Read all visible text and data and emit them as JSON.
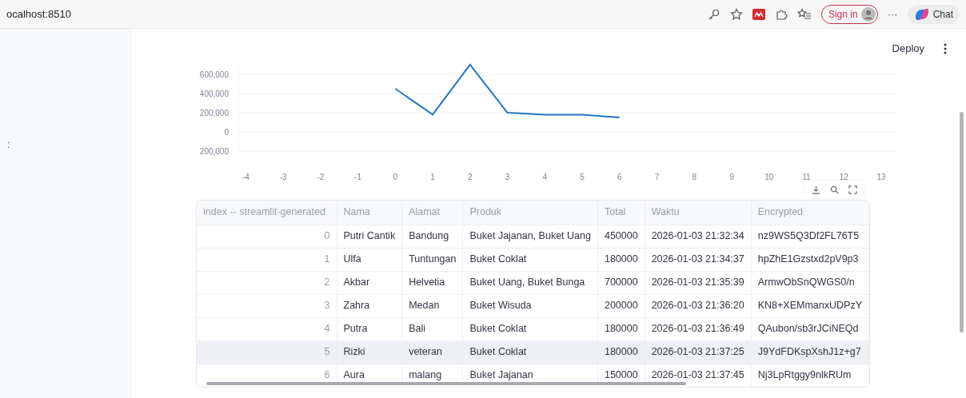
{
  "browser": {
    "address": "ocalhost:8510",
    "sign_in": "Sign in",
    "more": "···",
    "chat": "Chat"
  },
  "sidebar_marker": ":",
  "header": {
    "deploy": "Deploy"
  },
  "chart": {
    "chart_data": {
      "type": "line",
      "x": [
        0,
        1,
        2,
        3,
        4,
        5,
        6
      ],
      "series": [
        {
          "color": "#1f77c4",
          "values": [
            450000,
            180000,
            700000,
            200000,
            180000,
            180000,
            150000
          ]
        }
      ],
      "xlim": [
        -4.2,
        13.3
      ],
      "ylim": [
        -200000,
        700000
      ],
      "grid": true,
      "xticks": [
        -4,
        -3,
        -2,
        -1,
        0,
        1,
        2,
        3,
        4,
        5,
        6,
        7,
        8,
        9,
        10,
        11,
        12,
        13
      ],
      "yticks": [
        {
          "value": 600000,
          "label": "600,000"
        },
        {
          "value": 400000,
          "label": "400,000"
        },
        {
          "value": 200000,
          "label": "200,000"
        },
        {
          "value": 0,
          "label": "0"
        },
        {
          "value": -200000,
          "label": "200,000"
        }
      ]
    }
  },
  "table": {
    "columns": [
      "index -- streamlit-generated",
      "Nama",
      "Alamat",
      "Produk",
      "Total",
      "Waktu",
      "Encrypted"
    ],
    "rows": [
      {
        "highlighted": false,
        "cells": [
          "0",
          "Putri Cantik",
          "Bandung",
          "Buket Jajanan, Buket Uang",
          "450000",
          "2026-01-03 21:32:34",
          "nz9WS5Q3Df2FL76T5"
        ]
      },
      {
        "highlighted": false,
        "cells": [
          "1",
          "Ulfa",
          "Tuntungan",
          "Buket Coklat",
          "180000",
          "2026-01-03 21:34:37",
          "hpZhE1Gzstxd2pV9p3"
        ]
      },
      {
        "highlighted": false,
        "cells": [
          "2",
          "Akbar",
          "Helvetia",
          "Buket Uang, Buket Bunga",
          "700000",
          "2026-01-03 21:35:39",
          "ArmwObSnQWGS0/n"
        ]
      },
      {
        "highlighted": false,
        "cells": [
          "3",
          "Zahra",
          "Medan",
          "Buket Wisuda",
          "200000",
          "2026-01-03 21:36:20",
          "KN8+XEMmanxUDPzY"
        ]
      },
      {
        "highlighted": false,
        "cells": [
          "4",
          "Putra",
          "Bali",
          "Buket Coklat",
          "180000",
          "2026-01-03 21:36:49",
          "QAubon/sb3rJCiNEQd"
        ]
      },
      {
        "highlighted": true,
        "cells": [
          "5",
          "Rizki",
          "veteran",
          "Buket Coklat",
          "180000",
          "2026-01-03 21:37:25",
          "J9YdFDKspXshJ1z+g7"
        ]
      },
      {
        "highlighted": false,
        "cells": [
          "6",
          "Aura",
          "malang",
          "Buket Jajanan",
          "150000",
          "2026-01-03 21:37:45",
          "Nj3LpRtggy9nlkRUm"
        ]
      }
    ]
  }
}
